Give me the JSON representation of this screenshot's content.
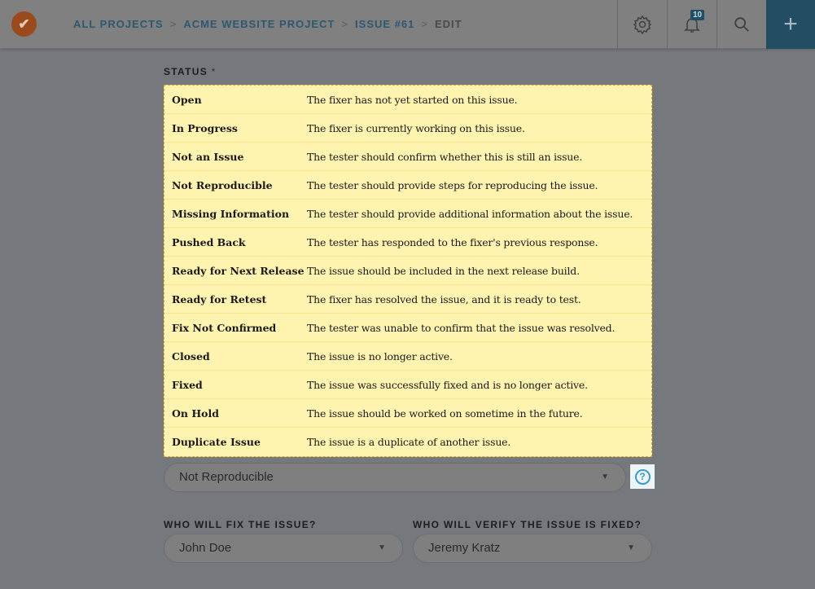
{
  "header": {
    "logo_icon": "double-check-logo",
    "breadcrumbs": [
      "ALL PROJECTS",
      "ACME WEBSITE PROJECT",
      "ISSUE #61"
    ],
    "current": "EDIT",
    "separator": ">",
    "notification_count": "10",
    "plus": "+"
  },
  "status": {
    "label": "STATUS",
    "required": "*",
    "options": [
      {
        "name": "Open",
        "desc": "The fixer has not yet started on this issue."
      },
      {
        "name": "In Progress",
        "desc": "The fixer is currently working on this issue."
      },
      {
        "name": "Not an Issue",
        "desc": "The tester should confirm whether this is still an issue."
      },
      {
        "name": "Not Reproducible",
        "desc": "The tester should provide steps for reproducing the issue."
      },
      {
        "name": "Missing Information",
        "desc": "The tester should provide additional information about the issue."
      },
      {
        "name": "Pushed Back",
        "desc": "The tester has responded to the fixer's previous response."
      },
      {
        "name": "Ready for Next Release",
        "desc": "The issue should be included in the next release build."
      },
      {
        "name": "Ready for Retest",
        "desc": "The fixer has resolved the issue, and it is ready to test."
      },
      {
        "name": "Fix Not Confirmed",
        "desc": "The tester was unable to confirm that the issue was resolved."
      },
      {
        "name": "Closed",
        "desc": "The issue is no longer active."
      },
      {
        "name": "Fixed",
        "desc": "The issue was successfully fixed and is no longer active."
      },
      {
        "name": "On Hold",
        "desc": "The issue should be worked on sometime in the future."
      },
      {
        "name": "Duplicate Issue",
        "desc": "The issue is a duplicate of another issue."
      }
    ],
    "selected": "Not Reproducible",
    "help": "?"
  },
  "fixer": {
    "label": "WHO WILL FIX THE ISSUE?",
    "value": "John Doe"
  },
  "verifier": {
    "label": "WHO WILL VERIFY THE ISSUE IS FIXED?",
    "value": "Jeremy Kratz"
  }
}
